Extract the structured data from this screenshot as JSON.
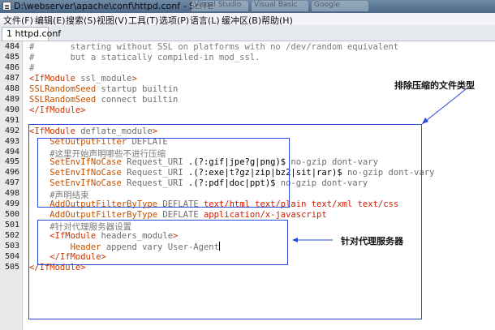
{
  "window": {
    "title": "D:\\webserver\\apache\\conf\\httpd.conf - SciTE",
    "ghost_tabs": [
      "Visual Studio",
      "Visual Basic",
      "Google"
    ]
  },
  "menubar": {
    "items": [
      "文件(F)",
      "编辑(E)",
      "搜索(S)",
      "视图(V)",
      "工具(T)",
      "选项(P)",
      "语言(L)",
      "缓冲区(B)",
      "帮助(H)"
    ]
  },
  "tab": {
    "label": "1 httpd.conf"
  },
  "editor": {
    "lines": [
      {
        "no": "484",
        "seg": [
          [
            "#       starting without SSL on platforms with no /dev/random equivalent",
            "c-com"
          ]
        ]
      },
      {
        "no": "485",
        "seg": [
          [
            "#       but a statically compiled-in mod_ssl.",
            "c-com"
          ]
        ]
      },
      {
        "no": "486",
        "seg": [
          [
            "#",
            "c-com"
          ]
        ]
      },
      {
        "no": "487",
        "seg": [
          [
            "<IfModule",
            "c-tag"
          ],
          [
            " ssl_module",
            "c-gray"
          ],
          [
            ">",
            "c-tag"
          ]
        ]
      },
      {
        "no": "488",
        "seg": [
          [
            "SSLRandomSeed",
            "c-ora"
          ],
          [
            " startup builtin",
            "c-gray"
          ]
        ]
      },
      {
        "no": "489",
        "seg": [
          [
            "SSLRandomSeed",
            "c-ora"
          ],
          [
            " connect builtin",
            "c-gray"
          ]
        ]
      },
      {
        "no": "490",
        "seg": [
          [
            "</IfModule>",
            "c-tag"
          ]
        ]
      },
      {
        "no": "491",
        "seg": []
      },
      {
        "no": "492",
        "seg": [
          [
            "<IfModule",
            "c-tag"
          ],
          [
            " deflate_module",
            "c-gray"
          ],
          [
            ">",
            "c-tag"
          ]
        ]
      },
      {
        "no": "493",
        "seg": [
          [
            "    ",
            "c-gray"
          ],
          [
            "SetOutputFilter",
            "c-ora"
          ],
          [
            " DEFLATE",
            "c-gray"
          ]
        ]
      },
      {
        "no": "494",
        "seg": [
          [
            "    #这里开始声明哪些不进行压缩",
            "c-com"
          ]
        ]
      },
      {
        "no": "495",
        "seg": [
          [
            "    ",
            "c-gray"
          ],
          [
            "SetEnvIfNoCase",
            "c-ora"
          ],
          [
            " Request_URI ",
            "c-gray"
          ],
          [
            ".(?:gif|jpe?g|png)$",
            "c-blk"
          ],
          [
            " no-gzip dont-vary",
            "c-gray"
          ]
        ]
      },
      {
        "no": "496",
        "seg": [
          [
            "    ",
            "c-gray"
          ],
          [
            "SetEnvIfNoCase",
            "c-ora"
          ],
          [
            " Request_URI ",
            "c-gray"
          ],
          [
            ".(?:exe|t?gz|zip|bz2|sit|rar)$",
            "c-blk"
          ],
          [
            " no-gzip dont-vary",
            "c-gray"
          ]
        ]
      },
      {
        "no": "497",
        "seg": [
          [
            "    ",
            "c-gray"
          ],
          [
            "SetEnvIfNoCase",
            "c-ora"
          ],
          [
            " Request_URI ",
            "c-gray"
          ],
          [
            ".(?:pdf|doc|ppt)$",
            "c-blk"
          ],
          [
            " no-gzip dont-vary",
            "c-gray"
          ]
        ]
      },
      {
        "no": "498",
        "seg": [
          [
            "    #声明结束",
            "c-com"
          ]
        ]
      },
      {
        "no": "499",
        "seg": [
          [
            "    ",
            "c-gray"
          ],
          [
            "AddOutputFilterByType",
            "c-ora"
          ],
          [
            " DEFLATE ",
            "c-gray"
          ],
          [
            "text/html text/plain text/xml text/css",
            "c-red"
          ]
        ]
      },
      {
        "no": "500",
        "seg": [
          [
            "    ",
            "c-gray"
          ],
          [
            "AddOutputFilterByType",
            "c-ora"
          ],
          [
            " DEFLATE ",
            "c-gray"
          ],
          [
            "application/x-javascript",
            "c-red"
          ]
        ]
      },
      {
        "no": "501",
        "seg": [
          [
            "    #针对代理服务器设置",
            "c-com"
          ]
        ]
      },
      {
        "no": "502",
        "seg": [
          [
            "    ",
            "c-gray"
          ],
          [
            "<IfModule",
            "c-tag"
          ],
          [
            " headers_module",
            "c-gray"
          ],
          [
            ">",
            "c-tag"
          ]
        ]
      },
      {
        "no": "503",
        "seg": [
          [
            "        ",
            "c-gray"
          ],
          [
            "Header",
            "c-ora"
          ],
          [
            " append vary User-Agent",
            "c-gray"
          ]
        ]
      },
      {
        "no": "504",
        "seg": [
          [
            "    ",
            "c-gray"
          ],
          [
            "</IfModule>",
            "c-tag"
          ]
        ]
      },
      {
        "no": "505",
        "seg": [
          [
            "</IfModule>",
            "c-tag"
          ]
        ]
      }
    ]
  },
  "annotations": {
    "compress_label": "排除压缩的文件类型",
    "proxy_label": "针对代理服务器"
  },
  "colors": {
    "annotation_box": "#2a4bd6",
    "tag": "#cc3300",
    "keyword": "#c05000",
    "mime": "#cc1a00",
    "comment": "#7a7a7a"
  }
}
